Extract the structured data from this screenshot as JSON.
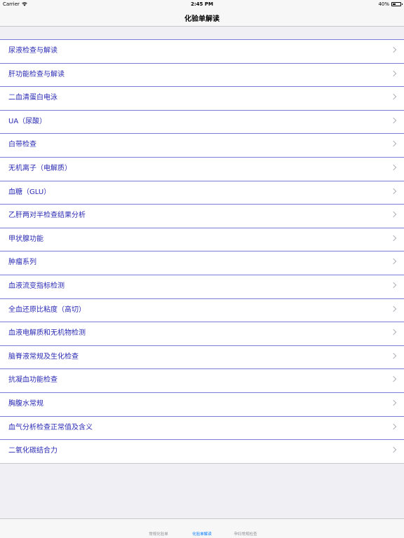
{
  "status_bar": {
    "carrier": "Carrier",
    "time": "2:45 PM",
    "battery": "40%",
    "battery_level": 0.4
  },
  "nav": {
    "title": "化验单解读"
  },
  "list": {
    "items": [
      "尿液检查与解读",
      "肝功能检查与解读",
      "二血清蛋白电泳",
      "UA（尿酸）",
      "白带检查",
      "无机离子（电解质）",
      "血糖（GLU）",
      "乙肝两对半检查结果分析",
      "甲状腺功能",
      "肿瘤系列",
      "血液流变指标检测",
      "全血还原比粘度（高切）",
      "血液电解质和无机物检测",
      "脑脊液常规及生化检查",
      "抗凝血功能检查",
      "胸腹水常规",
      "血气分析检查正常值及含义",
      "二氧化碳结合力"
    ]
  },
  "tab_bar": {
    "tabs": [
      {
        "label": "常规化验单",
        "active": false
      },
      {
        "label": "化验单解读",
        "active": true
      },
      {
        "label": "孕妇常规检查",
        "active": false
      }
    ],
    "active_color": "#007aff",
    "inactive_color": "#8e8e93"
  },
  "colors": {
    "item_text": "#2b2bb5",
    "separator": "#7b7bd9",
    "background": "#efeff4"
  }
}
